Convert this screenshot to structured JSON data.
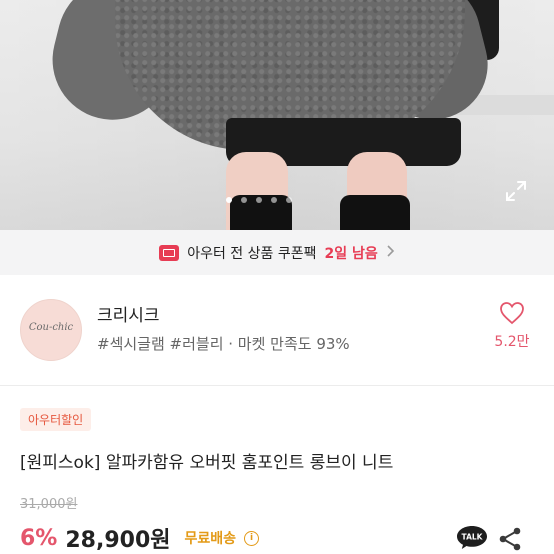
{
  "gallery": {
    "slide_count": 5,
    "active_slide": 1
  },
  "coupon_banner": {
    "text": "아우터 전 상품 쿠폰팩",
    "days_left": "2일 남음",
    "accent_color": "#e73c54"
  },
  "shop": {
    "logo_text": "Cou-chic",
    "name": "크리시크",
    "tags": "#섹시글램 #러블리 · 마켓 만족도 93%",
    "favorite_count": "5.2만"
  },
  "product": {
    "badge": "아우터할인",
    "title": "[원피스ok] 알파카함유 오버핏 홈포인트 롱브이 니트",
    "original_price": "31,000원",
    "discount": "6%",
    "price": "28,900원",
    "shipping": "무료배송",
    "talk_label": "TALK"
  },
  "colors": {
    "brand_pink": "#e4566c",
    "shipping_orange": "#e39a17"
  },
  "icons": {
    "expand": "expand-icon",
    "coupon": "coupon-icon",
    "heart": "heart-icon",
    "info": "info-icon",
    "talk": "kakao-talk-icon",
    "share": "share-icon"
  }
}
